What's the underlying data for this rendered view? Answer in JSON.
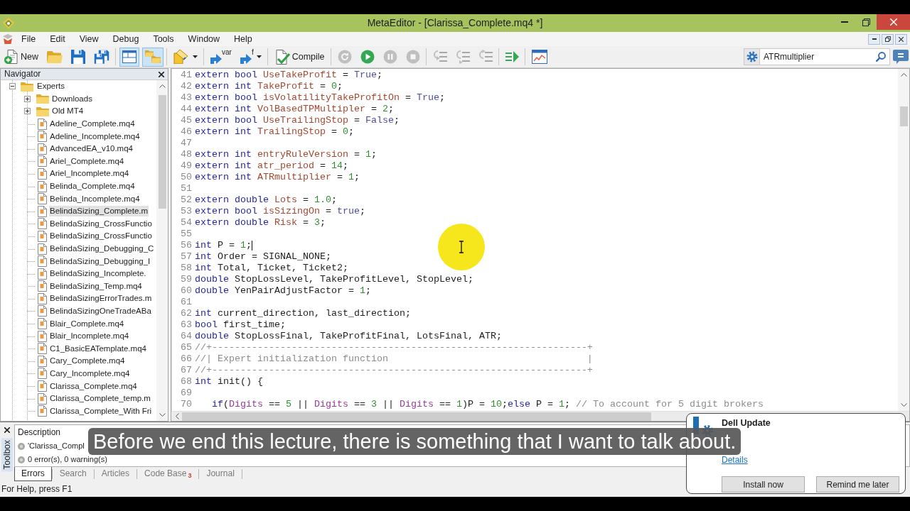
{
  "title_bar": {
    "title": "MetaEditor - [Clarissa_Complete.mq4 *]"
  },
  "menu": [
    "File",
    "Edit",
    "View",
    "Debug",
    "Tools",
    "Window",
    "Help"
  ],
  "toolbar": [
    {
      "kind": "labeled",
      "label": "New",
      "pressed": false,
      "disabled": false
    },
    {
      "kind": "icon",
      "pressed": false,
      "disabled": false
    },
    {
      "kind": "icon",
      "pressed": false,
      "disabled": false
    },
    {
      "kind": "icon",
      "pressed": false,
      "disabled": false
    },
    {
      "kind": "icon",
      "pressed": true,
      "disabled": false
    },
    {
      "kind": "icon",
      "pressed": true,
      "disabled": false
    },
    {
      "kind": "icon",
      "pressed": false,
      "disabled": false
    },
    {
      "kind": "tagged",
      "label": "var",
      "pressed": false,
      "disabled": false
    },
    {
      "kind": "tagged",
      "label": "f",
      "pressed": false,
      "disabled": false
    },
    {
      "kind": "labeled",
      "label": "Compile",
      "pressed": false,
      "disabled": false
    },
    {
      "kind": "icon",
      "pressed": false,
      "disabled": true
    },
    {
      "kind": "icon",
      "pressed": false,
      "disabled": false
    },
    {
      "kind": "icon",
      "pressed": false,
      "disabled": true
    },
    {
      "kind": "icon",
      "pressed": false,
      "disabled": true
    },
    {
      "kind": "icon",
      "pressed": false,
      "disabled": true
    },
    {
      "kind": "icon",
      "pressed": false,
      "disabled": true
    },
    {
      "kind": "icon",
      "pressed": false,
      "disabled": true
    },
    {
      "kind": "icon",
      "pressed": false,
      "disabled": false
    },
    {
      "kind": "icon",
      "pressed": false,
      "disabled": false
    }
  ],
  "search": {
    "value": "ATRmultiplier"
  },
  "navigator": {
    "title": "Navigator",
    "tree": [
      {
        "kind": "folder",
        "label": "Experts",
        "expanded": true,
        "selected": false,
        "children": [
          {
            "kind": "folder",
            "label": "Downloads",
            "expanded": false,
            "selected": false
          },
          {
            "kind": "folder",
            "label": "Old MT4",
            "expanded": false,
            "selected": false
          },
          {
            "kind": "file",
            "label": "Adeline_Complete.mq4",
            "selected": false
          },
          {
            "kind": "file",
            "label": "Adeline_Incomplete.mq4",
            "selected": false
          },
          {
            "kind": "file",
            "label": "AdvancedEA_v10.mq4",
            "selected": false
          },
          {
            "kind": "file",
            "label": "Ariel_Complete.mq4",
            "selected": false
          },
          {
            "kind": "file",
            "label": "Ariel_Incomplete.mq4",
            "selected": false
          },
          {
            "kind": "file",
            "label": "Belinda_Complete.mq4",
            "selected": false
          },
          {
            "kind": "file",
            "label": "Belinda_Incomplete.mq4",
            "selected": false
          },
          {
            "kind": "file",
            "label": "BelindaSizing_Complete.m",
            "selected": true
          },
          {
            "kind": "file",
            "label": "BelindaSizing_CrossFunctio",
            "selected": false
          },
          {
            "kind": "file",
            "label": "BelindaSizing_CrossFunctio",
            "selected": false
          },
          {
            "kind": "file",
            "label": "BelindaSizing_Debugging_C",
            "selected": false
          },
          {
            "kind": "file",
            "label": "BelindaSizing_Debugging_I",
            "selected": false
          },
          {
            "kind": "file",
            "label": "BelindaSizing_Incomplete.",
            "selected": false
          },
          {
            "kind": "file",
            "label": "BelindaSizing_Temp.mq4",
            "selected": false
          },
          {
            "kind": "file",
            "label": "BelindaSizingErrorTrades.m",
            "selected": false
          },
          {
            "kind": "file",
            "label": "BelindaSizingOneTradeABa",
            "selected": false
          },
          {
            "kind": "file",
            "label": "Blair_Complete.mq4",
            "selected": false
          },
          {
            "kind": "file",
            "label": "Blair_Incomplete.mq4",
            "selected": false
          },
          {
            "kind": "file",
            "label": "C1_BasicEATemplate.mq4",
            "selected": false
          },
          {
            "kind": "file",
            "label": "Cary_Complete.mq4",
            "selected": false
          },
          {
            "kind": "file",
            "label": "Cary_Incomplete.mq4",
            "selected": false
          },
          {
            "kind": "file",
            "label": "Clarissa_Complete.mq4",
            "selected": false
          },
          {
            "kind": "file",
            "label": "Clarissa_Complete_temp.m",
            "selected": false
          },
          {
            "kind": "file",
            "label": "Clarissa_Complete_With Fri",
            "selected": false
          }
        ]
      }
    ]
  },
  "editor": {
    "lines": [
      {
        "number": "41",
        "tokens": [
          {
            "kind": "keyword",
            "text": "extern bool "
          },
          {
            "kind": "input",
            "text": "UseTakeProfit"
          },
          {
            "kind": "plain",
            "text": " = "
          },
          {
            "kind": "constant",
            "text": "True"
          },
          {
            "kind": "plain",
            "text": ";"
          }
        ]
      },
      {
        "number": "42",
        "tokens": [
          {
            "kind": "keyword",
            "text": "extern int "
          },
          {
            "kind": "input",
            "text": "TakeProfit"
          },
          {
            "kind": "plain",
            "text": " = "
          },
          {
            "kind": "number",
            "text": "0"
          },
          {
            "kind": "plain",
            "text": ";"
          }
        ]
      },
      {
        "number": "43",
        "tokens": [
          {
            "kind": "keyword",
            "text": "extern bool "
          },
          {
            "kind": "input",
            "text": "isVolatilityTakeProfitOn"
          },
          {
            "kind": "plain",
            "text": " = "
          },
          {
            "kind": "constant",
            "text": "True"
          },
          {
            "kind": "plain",
            "text": ";"
          }
        ]
      },
      {
        "number": "44",
        "tokens": [
          {
            "kind": "keyword",
            "text": "extern int "
          },
          {
            "kind": "input",
            "text": "VolBasedTPMultipler"
          },
          {
            "kind": "plain",
            "text": " = "
          },
          {
            "kind": "number",
            "text": "2"
          },
          {
            "kind": "plain",
            "text": ";"
          }
        ]
      },
      {
        "number": "45",
        "tokens": [
          {
            "kind": "keyword",
            "text": "extern bool "
          },
          {
            "kind": "input",
            "text": "UseTrailingStop"
          },
          {
            "kind": "plain",
            "text": " = "
          },
          {
            "kind": "constant",
            "text": "False"
          },
          {
            "kind": "plain",
            "text": ";"
          }
        ]
      },
      {
        "number": "46",
        "tokens": [
          {
            "kind": "keyword",
            "text": "extern int "
          },
          {
            "kind": "input",
            "text": "TrailingStop"
          },
          {
            "kind": "plain",
            "text": " = "
          },
          {
            "kind": "number",
            "text": "0"
          },
          {
            "kind": "plain",
            "text": ";"
          }
        ]
      },
      {
        "number": "47"
      },
      {
        "number": "48",
        "tokens": [
          {
            "kind": "keyword",
            "text": "extern int "
          },
          {
            "kind": "input",
            "text": "entryRuleVersion"
          },
          {
            "kind": "plain",
            "text": " = "
          },
          {
            "kind": "number",
            "text": "1"
          },
          {
            "kind": "plain",
            "text": ";"
          }
        ]
      },
      {
        "number": "49",
        "tokens": [
          {
            "kind": "keyword",
            "text": "extern int "
          },
          {
            "kind": "input",
            "text": "atr_period"
          },
          {
            "kind": "plain",
            "text": " = "
          },
          {
            "kind": "number",
            "text": "14"
          },
          {
            "kind": "plain",
            "text": ";"
          }
        ]
      },
      {
        "number": "50",
        "tokens": [
          {
            "kind": "keyword",
            "text": "extern int "
          },
          {
            "kind": "input",
            "text": "ATRmultiplier"
          },
          {
            "kind": "plain",
            "text": " = "
          },
          {
            "kind": "number",
            "text": "1"
          },
          {
            "kind": "plain",
            "text": ";"
          }
        ]
      },
      {
        "number": "51"
      },
      {
        "number": "52",
        "tokens": [
          {
            "kind": "keyword",
            "text": "extern double "
          },
          {
            "kind": "input",
            "text": "Lots"
          },
          {
            "kind": "plain",
            "text": " = "
          },
          {
            "kind": "number",
            "text": "1.0"
          },
          {
            "kind": "plain",
            "text": ";"
          }
        ]
      },
      {
        "number": "53",
        "tokens": [
          {
            "kind": "keyword",
            "text": "extern bool "
          },
          {
            "kind": "input",
            "text": "isSizingOn"
          },
          {
            "kind": "plain",
            "text": " = "
          },
          {
            "kind": "constant",
            "text": "true"
          },
          {
            "kind": "plain",
            "text": ";"
          }
        ]
      },
      {
        "number": "54",
        "tokens": [
          {
            "kind": "keyword",
            "text": "extern double "
          },
          {
            "kind": "input",
            "text": "Risk"
          },
          {
            "kind": "plain",
            "text": " = "
          },
          {
            "kind": "number",
            "text": "3"
          },
          {
            "kind": "plain",
            "text": ";"
          }
        ]
      },
      {
        "number": "55"
      },
      {
        "number": "56",
        "tokens": [
          {
            "kind": "keyword",
            "text": "int"
          },
          {
            "kind": "plain",
            "text": " P = "
          },
          {
            "kind": "number",
            "text": "1"
          },
          {
            "kind": "plain",
            "text": ";"
          },
          {
            "kind": "caret"
          }
        ]
      },
      {
        "number": "57",
        "tokens": [
          {
            "kind": "keyword",
            "text": "int"
          },
          {
            "kind": "plain",
            "text": " Order = SIGNAL_NONE;"
          }
        ]
      },
      {
        "number": "58",
        "tokens": [
          {
            "kind": "keyword",
            "text": "int"
          },
          {
            "kind": "plain",
            "text": " Total, Ticket, Ticket2;"
          }
        ]
      },
      {
        "number": "59",
        "tokens": [
          {
            "kind": "keyword",
            "text": "double"
          },
          {
            "kind": "plain",
            "text": " StopLossLevel, TakeProfitLevel, StopLevel;"
          }
        ]
      },
      {
        "number": "60",
        "tokens": [
          {
            "kind": "keyword",
            "text": "double"
          },
          {
            "kind": "plain",
            "text": " YenPairAdjustFactor = "
          },
          {
            "kind": "number",
            "text": "1"
          },
          {
            "kind": "plain",
            "text": ";"
          }
        ]
      },
      {
        "number": "61"
      },
      {
        "number": "62",
        "tokens": [
          {
            "kind": "keyword",
            "text": "int"
          },
          {
            "kind": "plain",
            "text": " current_direction, last_direction;"
          }
        ]
      },
      {
        "number": "63",
        "tokens": [
          {
            "kind": "keyword",
            "text": "bool"
          },
          {
            "kind": "plain",
            "text": " first_time;"
          }
        ]
      },
      {
        "number": "64",
        "tokens": [
          {
            "kind": "keyword",
            "text": "double"
          },
          {
            "kind": "plain",
            "text": " StopLossFinal, TakeProfitFinal, LotsFinal, ATR;"
          }
        ]
      },
      {
        "number": "65",
        "tokens": [
          {
            "kind": "comment",
            "text": "//+------------------------------------------------------------------+"
          }
        ]
      },
      {
        "number": "66",
        "tokens": [
          {
            "kind": "comment",
            "text": "//| Expert initialization function                                   |"
          }
        ]
      },
      {
        "number": "67",
        "tokens": [
          {
            "kind": "comment",
            "text": "//+------------------------------------------------------------------+"
          }
        ]
      },
      {
        "number": "68",
        "tokens": [
          {
            "kind": "keyword",
            "text": "int"
          },
          {
            "kind": "plain",
            "text": " init() {"
          }
        ]
      },
      {
        "number": "69"
      },
      {
        "number": "70",
        "tokens": [
          {
            "kind": "keyword",
            "text": "   if"
          },
          {
            "kind": "plain",
            "text": "("
          },
          {
            "kind": "builtin",
            "text": "Digits"
          },
          {
            "kind": "plain",
            "text": " == "
          },
          {
            "kind": "number",
            "text": "5"
          },
          {
            "kind": "plain",
            "text": " || "
          },
          {
            "kind": "builtin",
            "text": "Digits"
          },
          {
            "kind": "plain",
            "text": " == "
          },
          {
            "kind": "number",
            "text": "3"
          },
          {
            "kind": "plain",
            "text": " || "
          },
          {
            "kind": "builtin",
            "text": "Digits"
          },
          {
            "kind": "plain",
            "text": " == "
          },
          {
            "kind": "number",
            "text": "1"
          },
          {
            "kind": "plain",
            "text": ")P = "
          },
          {
            "kind": "number",
            "text": "10"
          },
          {
            "kind": "plain",
            "text": ";"
          },
          {
            "kind": "keyword",
            "text": "else"
          },
          {
            "kind": "plain",
            "text": " P = "
          },
          {
            "kind": "number",
            "text": "1"
          },
          {
            "kind": "plain",
            "text": "; "
          },
          {
            "kind": "comment",
            "text": "// To account for 5 digit brokers"
          }
        ]
      }
    ]
  },
  "toolbox": {
    "title": "Toolbox",
    "columns": [
      "Description"
    ],
    "rows": [
      {
        "text": "'Clarissa_Compl"
      },
      {
        "text": "0 error(s), 0 warning(s)"
      }
    ],
    "tabs": [
      {
        "label": "Errors",
        "selected": true
      },
      {
        "label": "Search",
        "selected": false
      },
      {
        "label": "Articles",
        "selected": false
      },
      {
        "label": "Code Base",
        "badge": "3",
        "selected": false
      },
      {
        "label": "Journal",
        "selected": false
      }
    ]
  },
  "status_bar": {
    "text": "For Help, press F1"
  },
  "caption": "Before we end this lecture, there is something that I want to talk about.",
  "notification": {
    "title": "Dell Update",
    "link": "Details",
    "buttons": [
      "Install now",
      "Remind me later"
    ]
  }
}
